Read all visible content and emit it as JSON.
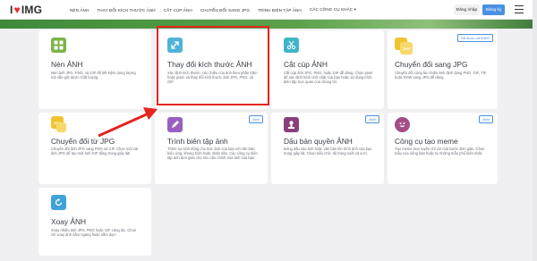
{
  "header": {
    "logo_left": "I",
    "logo_right": "IMG",
    "nav": [
      "NÉN ẢNH",
      "THAY ĐỔI KÍCH THƯỚC ẢNH",
      "CẮT CÚP ẢNH",
      "CHUYỂN ĐỔI SANG JPG",
      "TRÌNH BIÊN TẬP ẢNH",
      "CÁC CÔNG CỤ KHÁC ▾"
    ],
    "login": "Đăng nhập",
    "signup": "Đăng ký"
  },
  "tools": [
    {
      "title": "Nén ẢNH",
      "desc": "Nén ảnh JPG, PNG, và GIF để tiết kiệm dung lượng mà vẫn giữ được chất lượng.",
      "badge": "",
      "icon": "compress-icon",
      "color": "#7db348"
    },
    {
      "title": "Thay đổi kích thước ẢNH",
      "desc": "Xác định kích thước, các chiều của ảnh theo phần trăm hoặc pixel, và thay đổi kích thước ảnh JPG, PNG, và GIF.",
      "badge": "",
      "icon": "resize-icon",
      "color": "#4fb3d9"
    },
    {
      "title": "Cắt cúp ẢNH",
      "desc": "Cắt cúp ảnh JPG, PNG, hoặc GIF dễ dàng. Chọn pixel để xác định hình chữ nhật của bạn hoặc sử dụng trình biên tập trực quan của chúng tôi.",
      "badge": "",
      "icon": "crop-icon",
      "color": "#3fb5c9"
    },
    {
      "title": "Chuyển đổi sang JPG",
      "desc": "Chuyển đổi cùng lúc nhiều ảnh định dạng PNG, GIF, TIF, hoặc RAW sang JPG dễ dàng.",
      "badge": "Đã được cải thiện!",
      "icon": "to-jpg-icon",
      "color": "#f2c230"
    },
    {
      "title": "Chuyển đổi từ JPG",
      "desc": "Chuyển đổi ảnh JPG sang PNG và GIF. Chọn một vài ảnh JPG để tạo một ảnh GIF động trong giây lát!",
      "badge": "",
      "icon": "from-jpg-icon",
      "color": "#f2c230"
    },
    {
      "title": "Trình biên tập ảnh",
      "desc": "Thêm sự sinh động cho bức ảnh của bạn với văn bản, hiệu ứng, khung hình hoặc nhãn dán. Các công cụ biên tập ảnh đơn giản cho nhu cầu chỉnh sửa ảnh của bạn.",
      "badge": "Mới!",
      "icon": "edit-icon",
      "color": "#9a5fc0"
    },
    {
      "title": "Dấu bản quyền ẢNH",
      "desc": "Đóng dấu vào ảnh hoặc văn bản lên hình ảnh của bạn trong giây lát. Chọn kiểu chữ, độ trong suốt và vị trí.",
      "badge": "Mới!",
      "icon": "watermark-icon",
      "color": "#8a3f7a"
    },
    {
      "title": "Công cụ tạo meme",
      "desc": "Tạo meme trực tuyến chỉ với một bước đơn giản. Chọn mẫu của riêng bạn hoặc từ những mẫu phổ biến nhất.",
      "badge": "Mới!",
      "icon": "meme-icon",
      "color": "#a34c86"
    },
    {
      "title": "Xoay ẢNH",
      "desc": "Xoay nhiều ảnh JPG, PNG hoặc GIF cùng lúc. Chọn chỉ xoay ảnh nằm ngang hoặc nằm dọc!",
      "badge": "",
      "icon": "rotate-icon",
      "color": "#3fa3d9"
    }
  ]
}
